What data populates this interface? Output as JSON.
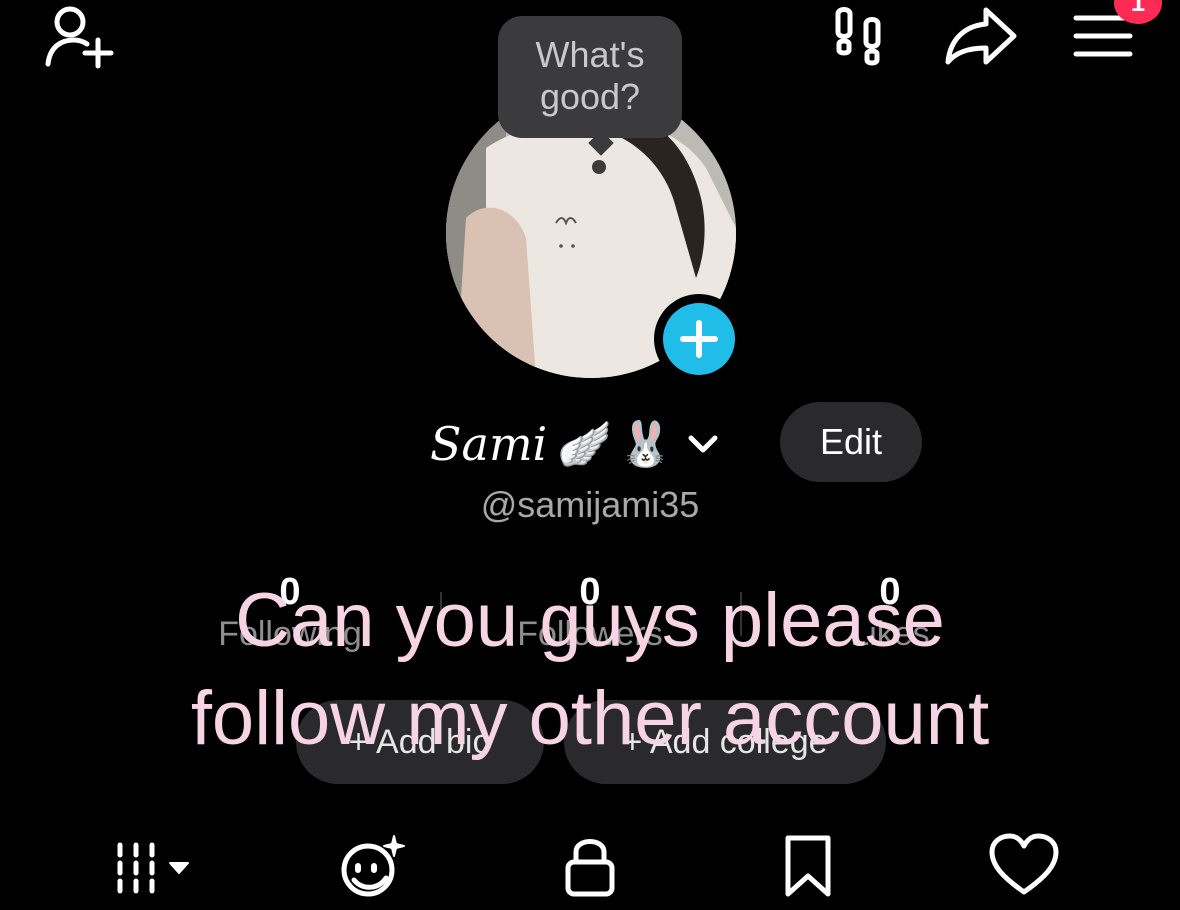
{
  "header": {
    "add_friend_icon": "person-add-icon",
    "footprints_icon": "footprints-icon",
    "share_icon": "share-arrow-icon",
    "menu_icon": "hamburger-menu-icon",
    "menu_badge": "1",
    "badge_color": "#fe2c55"
  },
  "profile": {
    "note_bubble": "What's good?",
    "display_name": "Sami",
    "name_emoji": "🪽🐰",
    "edit_label": "Edit",
    "username": "@samijami35",
    "avatar_add_color": "#20bde8"
  },
  "stats": [
    {
      "value": "0",
      "label": "Following"
    },
    {
      "value": "0",
      "label": "Followers"
    },
    {
      "value": "0",
      "label": "Likes"
    }
  ],
  "actions": {
    "add_bio": "+ Add bio",
    "add_college": "+ Add college"
  },
  "overlay": {
    "line1": "Can you guys please",
    "line2": "follow my other account",
    "color": "#f7d4e3"
  },
  "bottom_tabs": [
    {
      "icon": "grid-icon"
    },
    {
      "icon": "rewind-icon"
    },
    {
      "icon": "lock-icon"
    },
    {
      "icon": "bookmark-icon"
    },
    {
      "icon": "heart-icon"
    }
  ]
}
